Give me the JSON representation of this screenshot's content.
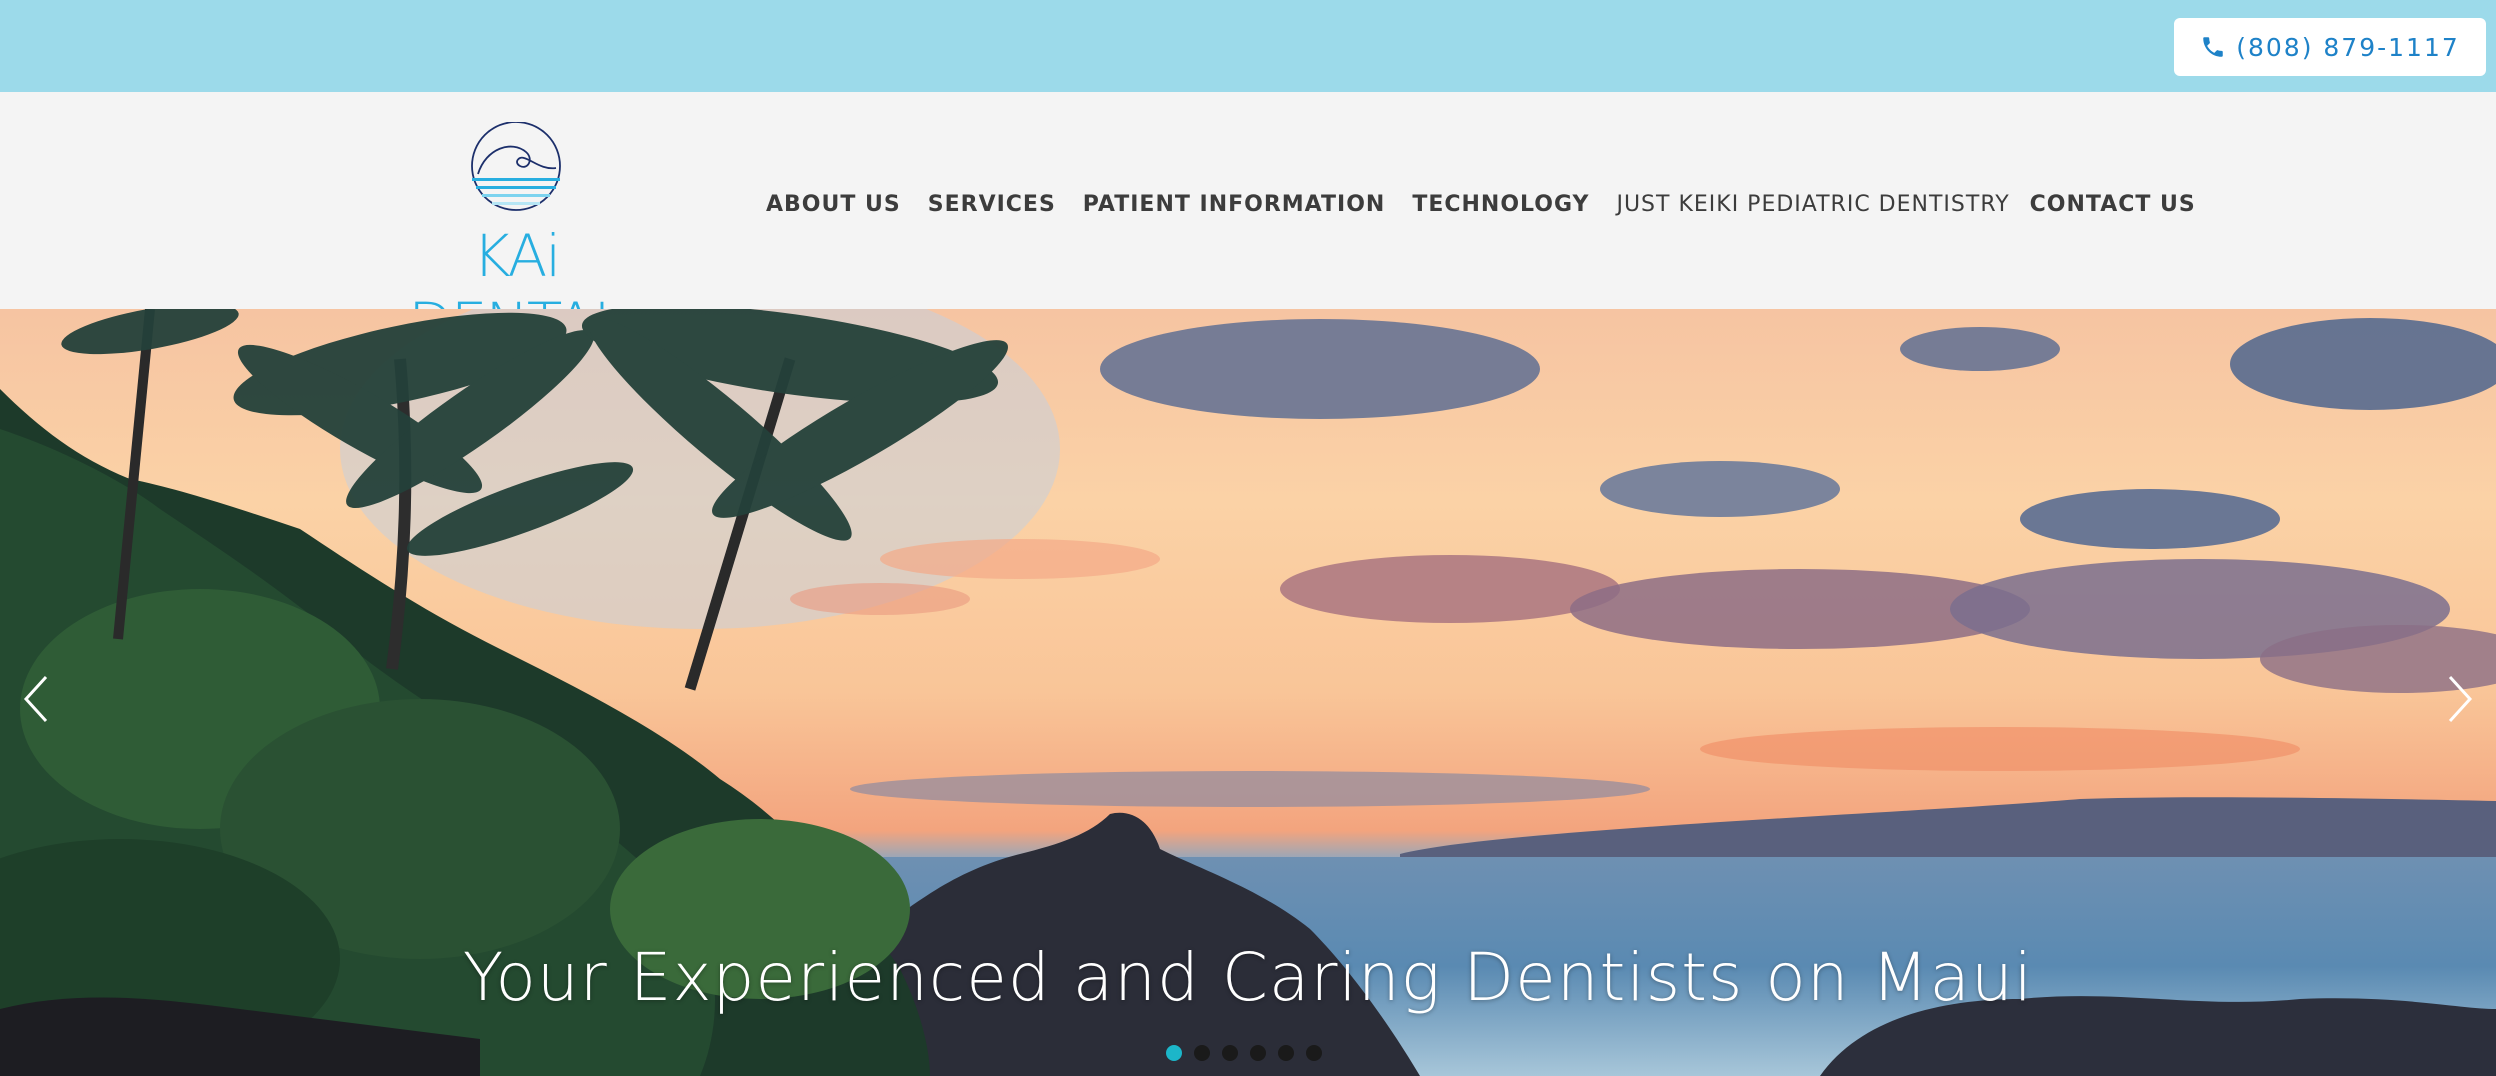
{
  "topbar": {
    "phone": "(808) 879-1117",
    "phone_icon": "phone-icon"
  },
  "header": {
    "logo_text": "KAi DENTAL",
    "nav": [
      {
        "label": "ABOUT US"
      },
      {
        "label": "SERVICES"
      },
      {
        "label": "PATIENT INFORMATION"
      },
      {
        "label": "TECHNOLOGY"
      },
      {
        "label": "JUST KEIKI PEDIATRIC DENTISTRY"
      },
      {
        "label": "CONTACT US"
      }
    ]
  },
  "hero": {
    "caption": "Your Experienced and Caring Dentists on Maui",
    "prev_icon": "chevron-left-icon",
    "next_icon": "chevron-right-icon",
    "slides_total": 6,
    "active_slide": 1
  },
  "colors": {
    "topbar_bg": "#9cdaea",
    "accent": "#1e82c8",
    "logo": "#27aee0",
    "active_dot": "#1cb6c9"
  }
}
